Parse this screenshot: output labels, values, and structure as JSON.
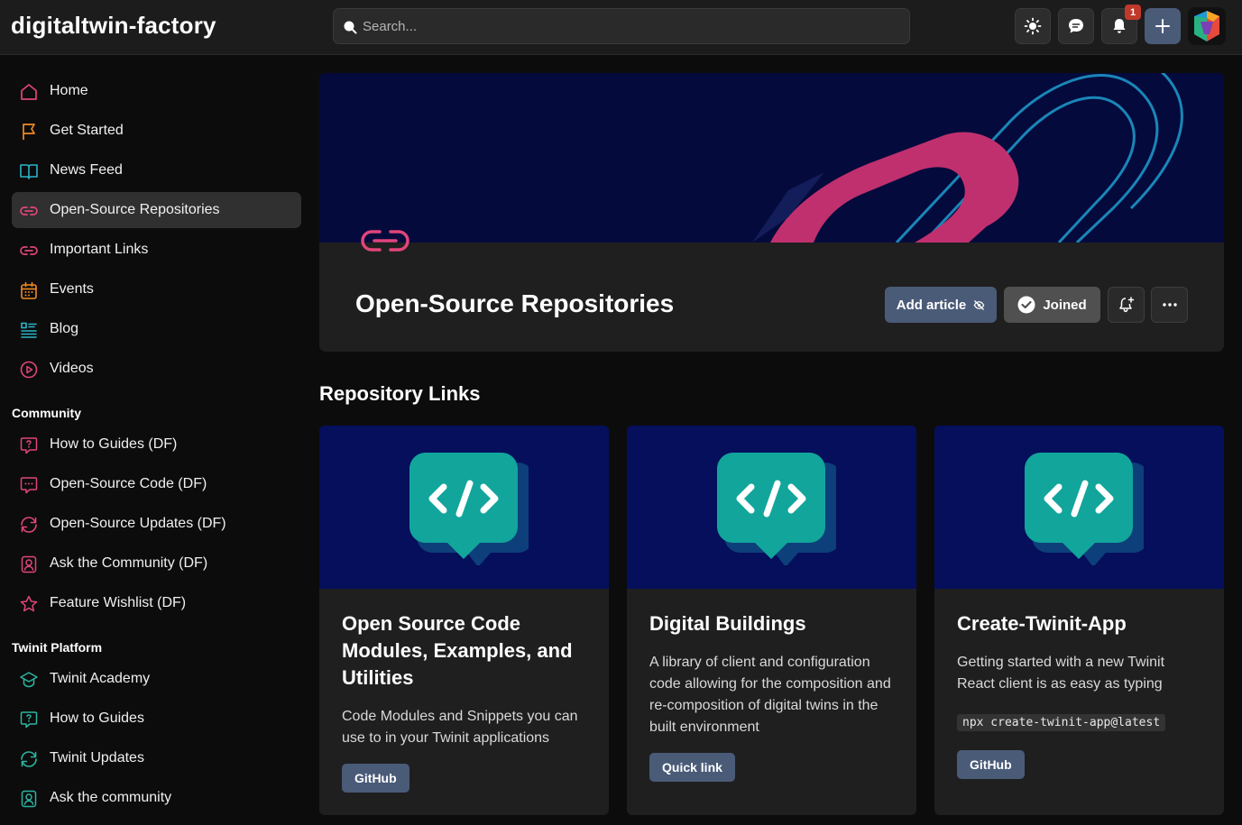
{
  "app": {
    "logo": "digitaltwin-factory"
  },
  "search": {
    "placeholder": "Search..."
  },
  "notifications": {
    "count": "1"
  },
  "sidebar": {
    "main_items": [
      {
        "label": "Home",
        "icon": "home-icon",
        "color": "#e0457b"
      },
      {
        "label": "Get Started",
        "icon": "flag-icon",
        "color": "#f08a24"
      },
      {
        "label": "News Feed",
        "icon": "book-open-icon",
        "color": "#2bb5c8"
      },
      {
        "label": "Open-Source Repositories",
        "icon": "link-icon",
        "color": "#e0457b",
        "active": true
      },
      {
        "label": "Important Links",
        "icon": "link-icon",
        "color": "#e0457b"
      },
      {
        "label": "Events",
        "icon": "calendar-icon",
        "color": "#f08a24"
      },
      {
        "label": "Blog",
        "icon": "list-icon",
        "color": "#2bb5c8"
      },
      {
        "label": "Videos",
        "icon": "play-circle-icon",
        "color": "#e0457b"
      }
    ],
    "community_title": "Community",
    "community_items": [
      {
        "label": "How to Guides (DF)",
        "icon": "question-bubble-icon",
        "color": "#e0457b"
      },
      {
        "label": "Open-Source Code (DF)",
        "icon": "chat-bubble-icon",
        "color": "#e0457b"
      },
      {
        "label": "Open-Source Updates (DF)",
        "icon": "refresh-icon",
        "color": "#e0457b"
      },
      {
        "label": "Ask the Community (DF)",
        "icon": "person-icon",
        "color": "#e0457b"
      },
      {
        "label": "Feature Wishlist (DF)",
        "icon": "star-icon",
        "color": "#e0457b"
      }
    ],
    "platform_title": "Twinit Platform",
    "platform_items": [
      {
        "label": "Twinit Academy",
        "icon": "graduation-cap-icon",
        "color": "#2bb5a0"
      },
      {
        "label": "How to Guides",
        "icon": "question-bubble-icon",
        "color": "#2bb5a0"
      },
      {
        "label": "Twinit Updates",
        "icon": "refresh-icon",
        "color": "#2bb5a0"
      },
      {
        "label": "Ask the community",
        "icon": "person-icon",
        "color": "#2bb5a0"
      }
    ]
  },
  "hero": {
    "title": "Open-Source Repositories",
    "add_article": "Add article",
    "joined": "Joined"
  },
  "section": {
    "heading": "Repository Links"
  },
  "cards": [
    {
      "title": "Open Source Code Modules, Examples, and Utilities",
      "description": "Code Modules and Snippets you can use to in your Twinit applications",
      "button": "GitHub"
    },
    {
      "title": "Digital Buildings",
      "description": "A library of client and configuration code allowing for the composition and re-composition of digital twins in the built environment",
      "button": "Quick link"
    },
    {
      "title": "Create-Twinit-App",
      "description": "Getting started with a new Twinit React client is as easy as typing",
      "code": "npx create-twinit-app@latest",
      "button": "GitHub"
    }
  ],
  "colors": {
    "accent_button": "#4a5b78",
    "banner_dark": "#050a3c",
    "card_banner": "#050f5c",
    "code_icon_teal": "#12a59b",
    "brand_pink": "#e0457b"
  }
}
